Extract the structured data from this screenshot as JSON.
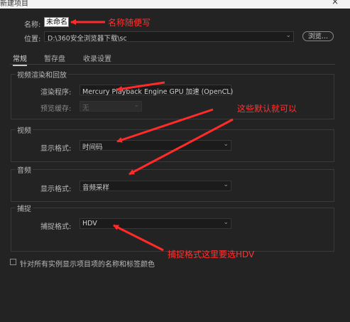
{
  "titlebar": {
    "title": "新建项目",
    "close": "×"
  },
  "form": {
    "name_label": "名称:",
    "name_value": "未命名",
    "location_label": "位置:",
    "location_value": "D:\\360安全浏览器下载\\sc",
    "browse_label": "浏览..."
  },
  "tabs": [
    {
      "label": "常规",
      "active": true
    },
    {
      "label": "暂存盘",
      "active": false
    },
    {
      "label": "收录设置",
      "active": false
    }
  ],
  "groups": {
    "video_rendering": {
      "title": "视频渲染和回放",
      "renderer_label": "渲染程序:",
      "renderer_value": "Mercury Playback Engine GPU 加速 (OpenCL)",
      "preview_cache_label": "预览缓存:",
      "preview_cache_value": "无"
    },
    "video": {
      "title": "视频",
      "format_label": "显示格式:",
      "format_value": "时间码"
    },
    "audio": {
      "title": "音频",
      "format_label": "显示格式:",
      "format_value": "音频采样"
    },
    "capture": {
      "title": "捕捉",
      "format_label": "捕捉格式:",
      "format_value": "HDV"
    }
  },
  "checkbox_label": "针对所有实例显示项目项的名称和标签颜色",
  "annotations": {
    "name_note": "名称随便写",
    "defaults_note": "这些默认就可以",
    "capture_note": "捕捉格式这里要选HDV",
    "color": "#ff2a2a"
  }
}
